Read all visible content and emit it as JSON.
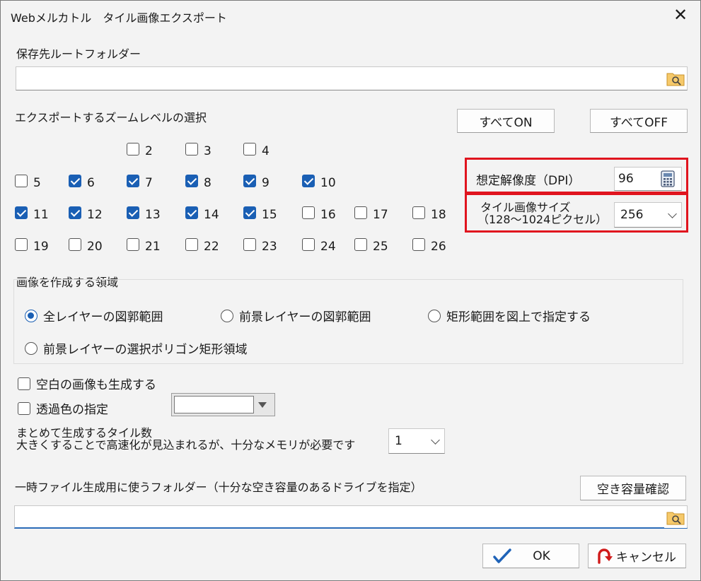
{
  "window": {
    "title": "Webメルカトル　タイル画像エクスポート",
    "close_symbol": "✕"
  },
  "root_folder": {
    "label": "保存先ルートフォルダー",
    "value": ""
  },
  "zoom": {
    "label": "エクスポートするズームレベルの選択",
    "all_on": "すべてON",
    "all_off": "すべてOFF",
    "levels": [
      {
        "n": "2",
        "checked": false
      },
      {
        "n": "3",
        "checked": false
      },
      {
        "n": "4",
        "checked": false
      },
      {
        "n": "5",
        "checked": false
      },
      {
        "n": "6",
        "checked": true
      },
      {
        "n": "7",
        "checked": true
      },
      {
        "n": "8",
        "checked": true
      },
      {
        "n": "9",
        "checked": true
      },
      {
        "n": "10",
        "checked": true
      },
      {
        "n": "11",
        "checked": true
      },
      {
        "n": "12",
        "checked": true
      },
      {
        "n": "13",
        "checked": true
      },
      {
        "n": "14",
        "checked": true
      },
      {
        "n": "15",
        "checked": true
      },
      {
        "n": "16",
        "checked": false
      },
      {
        "n": "17",
        "checked": false
      },
      {
        "n": "18",
        "checked": false
      },
      {
        "n": "19",
        "checked": false
      },
      {
        "n": "20",
        "checked": false
      },
      {
        "n": "21",
        "checked": false
      },
      {
        "n": "22",
        "checked": false
      },
      {
        "n": "23",
        "checked": false
      },
      {
        "n": "24",
        "checked": false
      },
      {
        "n": "25",
        "checked": false
      },
      {
        "n": "26",
        "checked": false
      }
    ]
  },
  "dpi": {
    "label": "想定解像度（DPI）",
    "value": "96"
  },
  "tile_size": {
    "label_line1": "タイル画像サイズ",
    "label_line2": "（128〜1024ピクセル）",
    "value": "256"
  },
  "region": {
    "label": "画像を作成する領域",
    "options": [
      {
        "label": "全レイヤーの図郭範囲",
        "checked": true
      },
      {
        "label": "前景レイヤーの図郭範囲",
        "checked": false
      },
      {
        "label": "矩形範囲を図上で指定する",
        "checked": false
      },
      {
        "label": "前景レイヤーの選択ポリゴン矩形領域",
        "checked": false
      }
    ]
  },
  "blank_images": {
    "label": "空白の画像も生成する",
    "checked": false
  },
  "transparent_color": {
    "label": "透過色の指定",
    "checked": false
  },
  "batch": {
    "line1": "まとめて生成するタイル数",
    "line2": "大きくすることで高速化が見込まれるが、十分なメモリが必要です",
    "value": "1"
  },
  "temp_folder": {
    "label": "一時ファイル生成用に使うフォルダー（十分な空き容量のあるドライブを指定）",
    "check_space": "空き容量確認",
    "value": ""
  },
  "ok": {
    "label": "OK"
  },
  "cancel": {
    "label": "キャンセル"
  },
  "colors": {
    "accent": "#1a5fb4",
    "highlight": "#e0141e",
    "folder": "#f0b429"
  }
}
